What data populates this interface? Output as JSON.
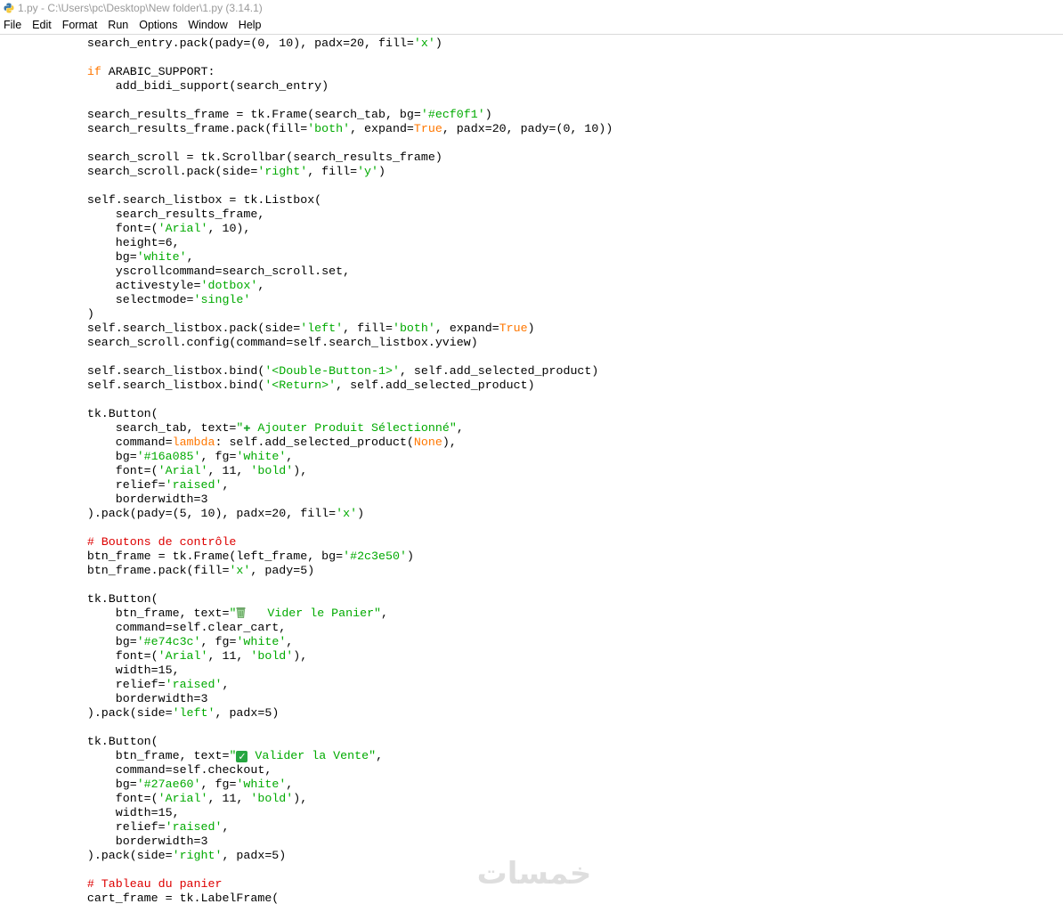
{
  "window": {
    "title": "1.py - C:\\Users\\pc\\Desktop\\New folder\\1.py (3.14.1)",
    "app_icon": "python-icon"
  },
  "menu": [
    "File",
    "Edit",
    "Format",
    "Run",
    "Options",
    "Window",
    "Help"
  ],
  "colors": {
    "keyword": "#ff7700",
    "string": "#00aa00",
    "comment": "#dd0000",
    "text": "#000000"
  },
  "watermark": {
    "text": "خمسات"
  },
  "code_lines": [
    [
      [
        "",
        "        search_entry.pack(pady=(0, 10), padx=20, fill="
      ],
      [
        "s",
        "'x'"
      ],
      [
        "",
        ")"
      ]
    ],
    [],
    [
      [
        "",
        "        "
      ],
      [
        "k",
        "if"
      ],
      [
        "",
        " ARABIC_SUPPORT:"
      ]
    ],
    [
      [
        "",
        "            add_bidi_support(search_entry)"
      ]
    ],
    [],
    [
      [
        "",
        "        search_results_frame = tk.Frame(search_tab, bg="
      ],
      [
        "s",
        "'#ecf0f1'"
      ],
      [
        "",
        ")"
      ]
    ],
    [
      [
        "",
        "        search_results_frame.pack(fill="
      ],
      [
        "s",
        "'both'"
      ],
      [
        "",
        ", expand="
      ],
      [
        "k",
        "True"
      ],
      [
        "",
        ", padx=20, pady=(0, 10))"
      ]
    ],
    [],
    [
      [
        "",
        "        search_scroll = tk.Scrollbar(search_results_frame)"
      ]
    ],
    [
      [
        "",
        "        search_scroll.pack(side="
      ],
      [
        "s",
        "'right'"
      ],
      [
        "",
        ", fill="
      ],
      [
        "s",
        "'y'"
      ],
      [
        "",
        ")"
      ]
    ],
    [],
    [
      [
        "",
        "        self.search_listbox = tk.Listbox("
      ]
    ],
    [
      [
        "",
        "            search_results_frame,"
      ]
    ],
    [
      [
        "",
        "            font=("
      ],
      [
        "s",
        "'Arial'"
      ],
      [
        "",
        ", 10),"
      ]
    ],
    [
      [
        "",
        "            height=6,"
      ]
    ],
    [
      [
        "",
        "            bg="
      ],
      [
        "s",
        "'white'"
      ],
      [
        "",
        ","
      ]
    ],
    [
      [
        "",
        "            yscrollcommand=search_scroll.set,"
      ]
    ],
    [
      [
        "",
        "            activestyle="
      ],
      [
        "s",
        "'dotbox'"
      ],
      [
        "",
        ","
      ]
    ],
    [
      [
        "",
        "            selectmode="
      ],
      [
        "s",
        "'single'"
      ]
    ],
    [
      [
        "",
        "        )"
      ]
    ],
    [
      [
        "",
        "        self.search_listbox.pack(side="
      ],
      [
        "s",
        "'left'"
      ],
      [
        "",
        ", fill="
      ],
      [
        "s",
        "'both'"
      ],
      [
        "",
        ", expand="
      ],
      [
        "k",
        "True"
      ],
      [
        "",
        ")"
      ]
    ],
    [
      [
        "",
        "        search_scroll.config(command=self.search_listbox.yview)"
      ]
    ],
    [],
    [
      [
        "",
        "        self.search_listbox.bind("
      ],
      [
        "s",
        "'<Double-Button-1>'"
      ],
      [
        "",
        ", self.add_selected_product)"
      ]
    ],
    [
      [
        "",
        "        self.search_listbox.bind("
      ],
      [
        "s",
        "'<Return>'"
      ],
      [
        "",
        ", self.add_selected_product)"
      ]
    ],
    [],
    [
      [
        "",
        "        tk.Button("
      ]
    ],
    [
      [
        "",
        "            search_tab, text="
      ],
      [
        "s",
        "\""
      ],
      [
        "plus",
        "✚"
      ],
      [
        "s",
        " Ajouter Produit Sélectionné\""
      ],
      [
        "",
        ","
      ]
    ],
    [
      [
        "",
        "            command="
      ],
      [
        "k",
        "lambda"
      ],
      [
        "",
        ": self.add_selected_product("
      ],
      [
        "k",
        "None"
      ],
      [
        "",
        "),"
      ]
    ],
    [
      [
        "",
        "            bg="
      ],
      [
        "s",
        "'#16a085'"
      ],
      [
        "",
        ", fg="
      ],
      [
        "s",
        "'white'"
      ],
      [
        "",
        ","
      ]
    ],
    [
      [
        "",
        "            font=("
      ],
      [
        "s",
        "'Arial'"
      ],
      [
        "",
        ", 11, "
      ],
      [
        "s",
        "'bold'"
      ],
      [
        "",
        "),"
      ]
    ],
    [
      [
        "",
        "            relief="
      ],
      [
        "s",
        "'raised'"
      ],
      [
        "",
        ","
      ]
    ],
    [
      [
        "",
        "            borderwidth=3"
      ]
    ],
    [
      [
        "",
        "        ).pack(pady=(5, 10), padx=20, fill="
      ],
      [
        "s",
        "'x'"
      ],
      [
        "",
        ")"
      ]
    ],
    [],
    [
      [
        "c",
        "        # Boutons de contrôle"
      ]
    ],
    [
      [
        "",
        "        btn_frame = tk.Frame(left_frame, bg="
      ],
      [
        "s",
        "'#2c3e50'"
      ],
      [
        "",
        ")"
      ]
    ],
    [
      [
        "",
        "        btn_frame.pack(fill="
      ],
      [
        "s",
        "'x'"
      ],
      [
        "",
        ", pady=5)"
      ]
    ],
    [],
    [
      [
        "",
        "        tk.Button("
      ]
    ],
    [
      [
        "",
        "            btn_frame, text="
      ],
      [
        "s",
        "\""
      ],
      [
        "trash",
        "wastebasket"
      ],
      [
        "s",
        "   Vider le Panier\""
      ],
      [
        "",
        ","
      ]
    ],
    [
      [
        "",
        "            command=self.clear_cart,"
      ]
    ],
    [
      [
        "",
        "            bg="
      ],
      [
        "s",
        "'#e74c3c'"
      ],
      [
        "",
        ", fg="
      ],
      [
        "s",
        "'white'"
      ],
      [
        "",
        ","
      ]
    ],
    [
      [
        "",
        "            font=("
      ],
      [
        "s",
        "'Arial'"
      ],
      [
        "",
        ", 11, "
      ],
      [
        "s",
        "'bold'"
      ],
      [
        "",
        "),"
      ]
    ],
    [
      [
        "",
        "            width=15,"
      ]
    ],
    [
      [
        "",
        "            relief="
      ],
      [
        "s",
        "'raised'"
      ],
      [
        "",
        ","
      ]
    ],
    [
      [
        "",
        "            borderwidth=3"
      ]
    ],
    [
      [
        "",
        "        ).pack(side="
      ],
      [
        "s",
        "'left'"
      ],
      [
        "",
        ", padx=5)"
      ]
    ],
    [],
    [
      [
        "",
        "        tk.Button("
      ]
    ],
    [
      [
        "",
        "            btn_frame, text="
      ],
      [
        "s",
        "\""
      ],
      [
        "check",
        "✓"
      ],
      [
        "s",
        " Valider la Vente\""
      ],
      [
        "",
        ","
      ]
    ],
    [
      [
        "",
        "            command=self.checkout,"
      ]
    ],
    [
      [
        "",
        "            bg="
      ],
      [
        "s",
        "'#27ae60'"
      ],
      [
        "",
        ", fg="
      ],
      [
        "s",
        "'white'"
      ],
      [
        "",
        ","
      ]
    ],
    [
      [
        "",
        "            font=("
      ],
      [
        "s",
        "'Arial'"
      ],
      [
        "",
        ", 11, "
      ],
      [
        "s",
        "'bold'"
      ],
      [
        "",
        "),"
      ]
    ],
    [
      [
        "",
        "            width=15,"
      ]
    ],
    [
      [
        "",
        "            relief="
      ],
      [
        "s",
        "'raised'"
      ],
      [
        "",
        ","
      ]
    ],
    [
      [
        "",
        "            borderwidth=3"
      ]
    ],
    [
      [
        "",
        "        ).pack(side="
      ],
      [
        "s",
        "'right'"
      ],
      [
        "",
        ", padx=5)"
      ]
    ],
    [],
    [
      [
        "c",
        "        # Tableau du panier"
      ]
    ],
    [
      [
        "",
        "        cart_frame = tk.LabelFrame("
      ]
    ]
  ]
}
